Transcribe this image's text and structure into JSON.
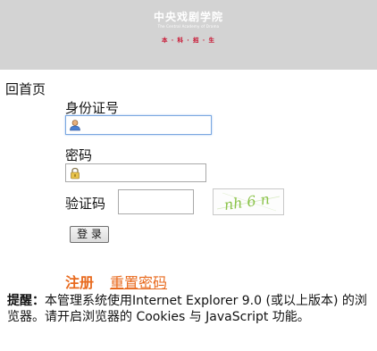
{
  "header": {
    "logo_calligraphy": "中央戏剧学院",
    "logo_english": "The Central Academy of Drama",
    "logo_subtitle": "本 · 科 · 招 · 生"
  },
  "nav": {
    "back_home": "回首页"
  },
  "form": {
    "id_label": "身份证号",
    "id_value": "",
    "password_label": "密码",
    "password_value": "",
    "captcha_label": "验证码",
    "captcha_value": "",
    "captcha_text": "nh 6 n",
    "login_button": "登 录"
  },
  "links": {
    "register": "注册",
    "reset_password": "重置密码"
  },
  "notice": {
    "prefix": "提醒：",
    "text": "本管理系统使用Internet Explorer 9.0 (或以上版本) 的浏览器。请开启浏览器的 Cookies 与 JavaScript 功能。"
  },
  "colors": {
    "header_bg": "#d3d3d3",
    "link_orange": "#e86a1e",
    "captcha_green": "#8bc34a"
  }
}
